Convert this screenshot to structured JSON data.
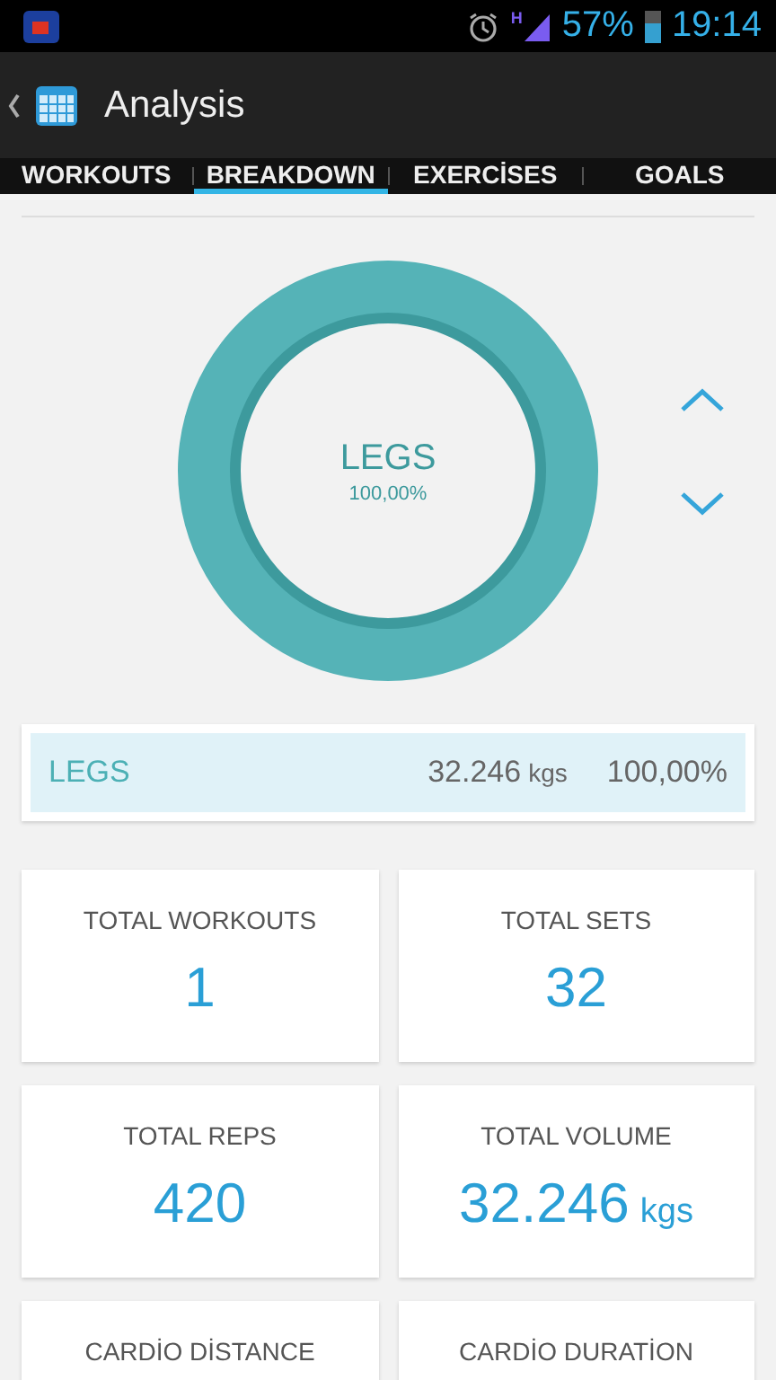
{
  "status_bar": {
    "network_type": "H",
    "battery_text": "57%",
    "time": "19:14"
  },
  "action_bar": {
    "title": "Analysis"
  },
  "tabs": [
    {
      "label": "WORKOUTS",
      "selected": false
    },
    {
      "label": "BREAKDOWN",
      "selected": true
    },
    {
      "label": "EXERCİSES",
      "selected": false
    },
    {
      "label": "GOALS",
      "selected": false
    }
  ],
  "chart": {
    "center_label": "LEGS",
    "center_value": "100,00%"
  },
  "legend": [
    {
      "name": "LEGS",
      "amount": "32.246",
      "unit": "kgs",
      "percent": "100,00%",
      "selected": true
    }
  ],
  "stats": [
    {
      "label": "TOTAL WORKOUTS",
      "value": "1"
    },
    {
      "label": "TOTAL SETS",
      "value": "32"
    },
    {
      "label": "TOTAL REPS",
      "value": "420"
    },
    {
      "label": "TOTAL VOLUME",
      "value": "32.246",
      "unit": "kgs"
    },
    {
      "label": "CARDİO DİSTANCE"
    },
    {
      "label": "CARDİO DURATİON"
    }
  ]
}
